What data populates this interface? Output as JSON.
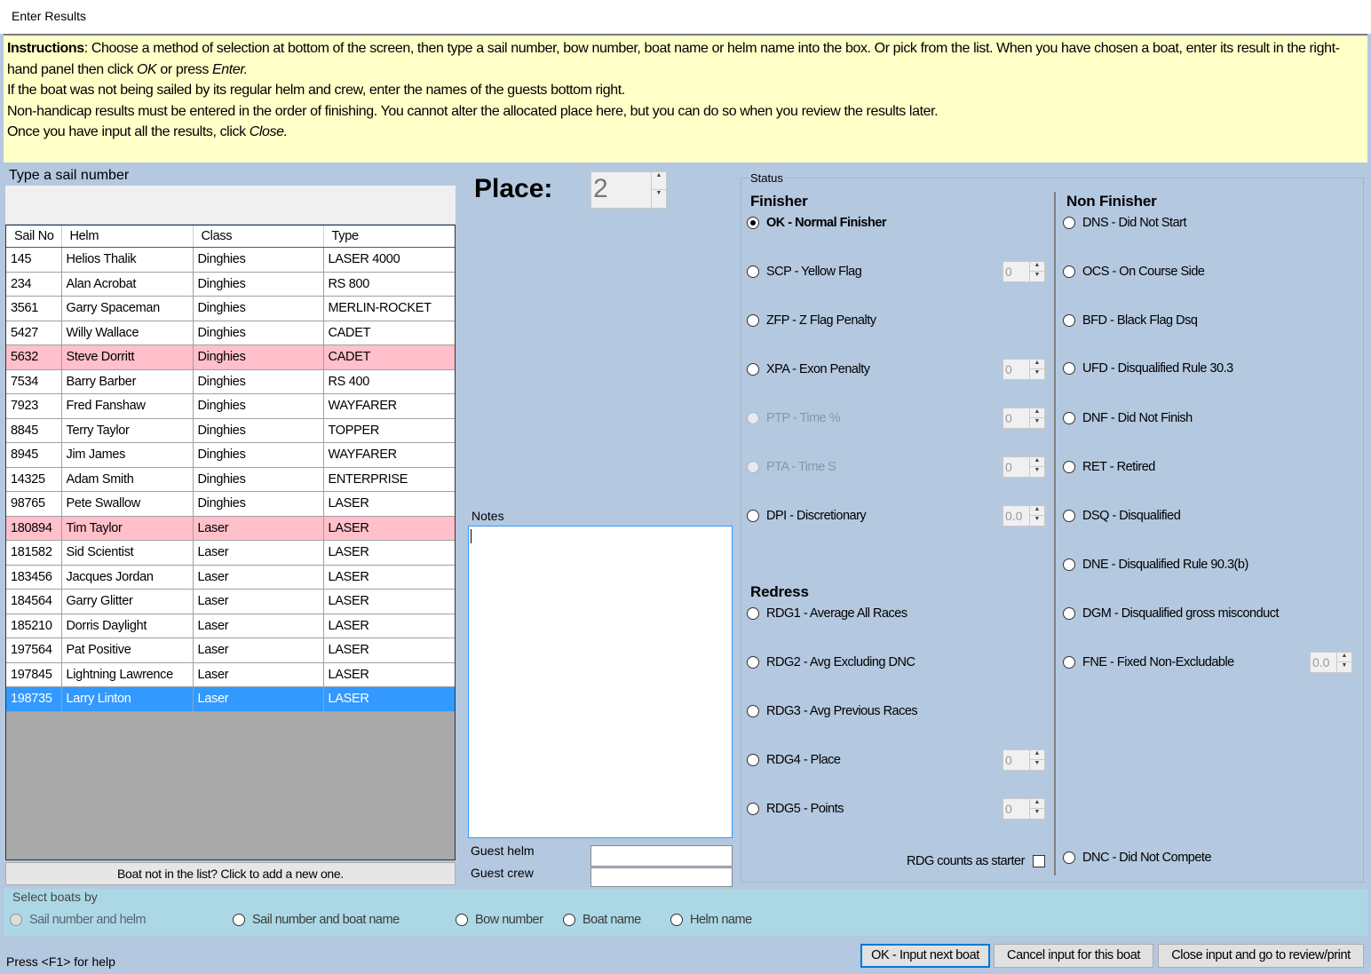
{
  "window": {
    "title": "Enter Results"
  },
  "instructions": {
    "bold_label": "Instructions",
    "line1_a": ": Choose a method of selection at bottom of the screen, then type a sail number, bow number, boat name or helm name into the box. Or pick from the list. When you have chosen a boat, enter its result in the right-hand panel then click ",
    "ok_word": "OK",
    "line1_b": " or press ",
    "enter_word": "Enter.",
    "line2": "If the boat was not being sailed by its regular helm and crew, enter the names of the guests bottom right.",
    "line3": "Non-handicap results must be entered in the order of finishing. You cannot alter the allocated place here, but you can do so when you review the results later.",
    "line4_a": "Once you have input all the results, click ",
    "close_word": "Close."
  },
  "selector": {
    "label": "Type a sail number",
    "value": ""
  },
  "table": {
    "columns": [
      "Sail No",
      "Helm",
      "Class",
      "Type"
    ],
    "rows": [
      {
        "sail": "145",
        "helm": "Helios Thalik",
        "class": "Dinghies",
        "type": "LASER 4000",
        "state": ""
      },
      {
        "sail": "234",
        "helm": "Alan Acrobat",
        "class": "Dinghies",
        "type": "RS 800",
        "state": ""
      },
      {
        "sail": "3561",
        "helm": "Garry Spaceman",
        "class": "Dinghies",
        "type": "MERLIN-ROCKET",
        "state": ""
      },
      {
        "sail": "5427",
        "helm": "Willy Wallace",
        "class": "Dinghies",
        "type": "CADET",
        "state": ""
      },
      {
        "sail": "5632",
        "helm": "Steve Dorritt",
        "class": "Dinghies",
        "type": "CADET",
        "state": "flag"
      },
      {
        "sail": "7534",
        "helm": "Barry Barber",
        "class": "Dinghies",
        "type": "RS 400",
        "state": ""
      },
      {
        "sail": "7923",
        "helm": "Fred Fanshaw",
        "class": "Dinghies",
        "type": "WAYFARER",
        "state": ""
      },
      {
        "sail": "8845",
        "helm": "Terry Taylor",
        "class": "Dinghies",
        "type": "TOPPER",
        "state": ""
      },
      {
        "sail": "8945",
        "helm": "Jim James",
        "class": "Dinghies",
        "type": "WAYFARER",
        "state": ""
      },
      {
        "sail": "14325",
        "helm": "Adam Smith",
        "class": "Dinghies",
        "type": "ENTERPRISE",
        "state": ""
      },
      {
        "sail": "98765",
        "helm": "Pete Swallow",
        "class": "Dinghies",
        "type": "LASER",
        "state": ""
      },
      {
        "sail": "180894",
        "helm": "Tim Taylor",
        "class": "Laser",
        "type": "LASER",
        "state": "flag"
      },
      {
        "sail": "181582",
        "helm": "Sid Scientist",
        "class": "Laser",
        "type": "LASER",
        "state": ""
      },
      {
        "sail": "183456",
        "helm": "Jacques Jordan",
        "class": "Laser",
        "type": "LASER",
        "state": ""
      },
      {
        "sail": "184564",
        "helm": "Garry Glitter",
        "class": "Laser",
        "type": "LASER",
        "state": ""
      },
      {
        "sail": "185210",
        "helm": "Dorris Daylight",
        "class": "Laser",
        "type": "LASER",
        "state": ""
      },
      {
        "sail": "197564",
        "helm": "Pat Positive",
        "class": "Laser",
        "type": "LASER",
        "state": ""
      },
      {
        "sail": "197845",
        "helm": "Lightning Lawrence",
        "class": "Laser",
        "type": "LASER",
        "state": ""
      },
      {
        "sail": "198735",
        "helm": "Larry Linton",
        "class": "Laser",
        "type": "LASER",
        "state": "sel"
      }
    ]
  },
  "add_boat_label": "Boat not in the list? Click to add a new one.",
  "place": {
    "label": "Place:",
    "value": "2"
  },
  "notes": {
    "label": "Notes",
    "value": ""
  },
  "guest": {
    "helm_label": "Guest helm",
    "crew_label": "Guest crew",
    "helm_value": "",
    "crew_value": ""
  },
  "status": {
    "label": "Status",
    "finisher_title": "Finisher",
    "redress_title": "Redress",
    "nonfinisher_title": "Non Finisher",
    "ok_label": "OK - Normal Finisher",
    "scp_label": "SCP - Yellow Flag",
    "scp_value": "0",
    "zfp_label": "ZFP - Z Flag Penalty",
    "xpa_label": "XPA - Exon Penalty",
    "xpa_value": "0",
    "ptp_label": "PTP - Time %",
    "ptp_value": "0",
    "pta_label": "PTA - Time S",
    "pta_value": "0",
    "dpi_label": "DPI - Discretionary",
    "dpi_value": "0.0",
    "rdg1_label": "RDG1 - Average All Races",
    "rdg2_label": "RDG2 - Avg Excluding DNC",
    "rdg3_label": "RDG3 - Avg Previous Races",
    "rdg4_label": "RDG4 - Place",
    "rdg4_value": "0",
    "rdg5_label": "RDG5 - Points",
    "rdg5_value": "0",
    "rdg_starter_label": "RDG counts as starter",
    "dns_label": "DNS - Did Not Start",
    "ocs_label": "OCS - On Course Side",
    "bfd_label": "BFD - Black Flag Dsq",
    "ufd_label": "UFD - Disqualified Rule 30.3",
    "dnf_label": "DNF - Did Not Finish",
    "ret_label": "RET - Retired",
    "dsq_label": "DSQ - Disqualified",
    "dne_label": "DNE - Disqualified Rule 90.3(b)",
    "dgm_label": "DGM - Disqualified gross misconduct",
    "fne_label": "FNE - Fixed Non-Excludable",
    "fne_value": "0.0",
    "dnc_label": "DNC - Did Not Compete"
  },
  "select_by": {
    "label": "Select boats by",
    "options": [
      "Sail number and helm",
      "Sail number and boat name",
      "Bow number",
      "Boat name",
      "Helm name"
    ]
  },
  "buttons": {
    "ok": "OK - Input next boat",
    "cancel": "Cancel input for this boat",
    "close": "Close input and go to review/print"
  },
  "help_text": "Press <F1> for help"
}
